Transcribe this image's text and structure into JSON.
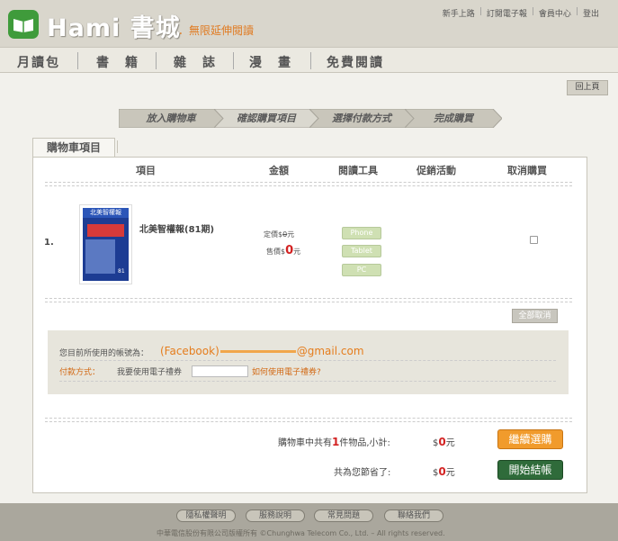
{
  "header": {
    "logo_text": "Hami 書城",
    "tagline": "．無限延伸閱讀",
    "top_links": [
      "新手上路",
      "訂閱電子報",
      "會員中心",
      "登出"
    ]
  },
  "main_nav": {
    "tabs": [
      "月讀包",
      "書　籍",
      "雜　誌",
      "漫　畫",
      "免費閱讀"
    ]
  },
  "back_button": "回上頁",
  "steps": [
    {
      "label": "放入購物車",
      "active": false
    },
    {
      "label": "確認購買項目",
      "active": true
    },
    {
      "label": "選擇付款方式",
      "active": false
    },
    {
      "label": "完成購買",
      "active": false
    }
  ],
  "section_title": "購物車項目",
  "columns": [
    "項目",
    "金額",
    "閱讀工具",
    "促銷活動",
    "取消購買"
  ],
  "cart_items": [
    {
      "index": "1.",
      "cover_title": "北美智權報",
      "cover_number": "81",
      "title": "北美智權報(81期)",
      "list_price_label": "定價$",
      "list_price_value": "0",
      "sale_price_label": "售價$",
      "sale_price_value": "0",
      "currency_unit": "元",
      "reading_tools": [
        "Phone",
        "Tablet",
        "PC"
      ],
      "cancel_checked": false
    }
  ],
  "cancel_all_button": "全部取消",
  "account": {
    "label": "您目前所使用的帳號為：",
    "value_prefix": "(Facebook)",
    "value_suffix": "@gmail.com"
  },
  "payment": {
    "label": "付款方式：",
    "voucher_label": "我要使用電子禮券",
    "voucher_value": "",
    "voucher_help": "如何使用電子禮券?"
  },
  "summary": {
    "count_prefix": "購物車中共有",
    "count": "1",
    "count_suffix": "件物品,小計:",
    "subtotal_symbol": "$",
    "subtotal": "0",
    "subtotal_unit": "元",
    "saved_label": "共為您節省了:",
    "saved_symbol": "$",
    "saved": "0",
    "saved_unit": "元"
  },
  "buttons": {
    "continue": "繼續選購",
    "checkout": "開始結帳"
  },
  "footer": {
    "links": [
      "隱私權聲明",
      "服務說明",
      "常見問題",
      "聯絡我們"
    ],
    "copyright": "中華電信股份有限公司版權所有 ©Chunghwa Telecom Co., Ltd. – All rights reserved."
  },
  "colors": {
    "accent_orange": "#f19b2c",
    "checkout_green": "#2f6b3a",
    "price_red": "#d32222",
    "logo_green": "#3f9b3b"
  }
}
